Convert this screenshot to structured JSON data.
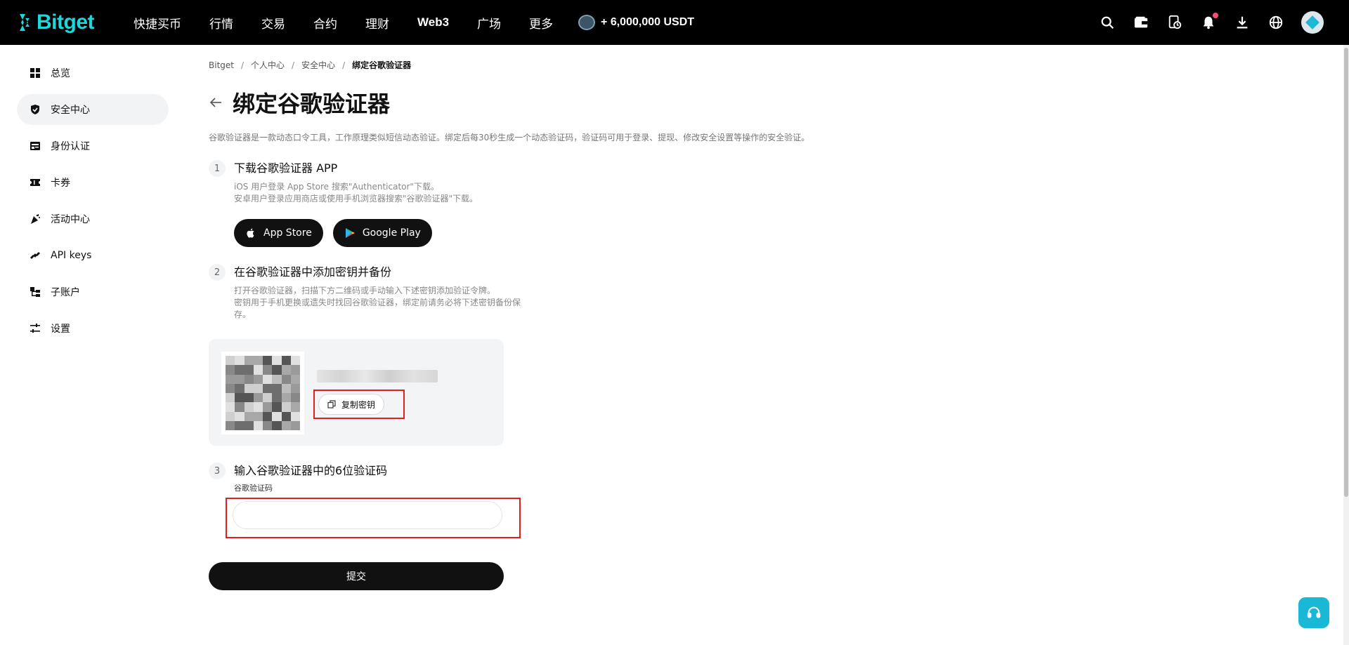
{
  "brand": {
    "name": "Bitget",
    "color": "#1ed7db"
  },
  "nav": {
    "items": [
      "快捷买币",
      "行情",
      "交易",
      "合约",
      "理财",
      "Web3",
      "广场",
      "更多"
    ],
    "promo": "+ 6,000,000 USDT"
  },
  "top_icons": [
    "search-icon",
    "wallet-icon",
    "orders-icon",
    "bell-icon",
    "download-icon",
    "globe-icon"
  ],
  "sidebar": {
    "items": [
      {
        "label": "总览",
        "icon": "grid-icon"
      },
      {
        "label": "安全中心",
        "icon": "shield-icon",
        "active": true
      },
      {
        "label": "身份认证",
        "icon": "id-card-icon"
      },
      {
        "label": "卡券",
        "icon": "ticket-icon"
      },
      {
        "label": "活动中心",
        "icon": "party-icon"
      },
      {
        "label": "API keys",
        "icon": "api-icon"
      },
      {
        "label": "子账户",
        "icon": "subaccount-icon"
      },
      {
        "label": "设置",
        "icon": "settings-icon"
      }
    ]
  },
  "breadcrumb": [
    "Bitget",
    "个人中心",
    "安全中心",
    "绑定谷歌验证器"
  ],
  "page": {
    "title": "绑定谷歌验证器",
    "description": "谷歌验证器是一款动态口令工具，工作原理类似短信动态验证。绑定后每30秒生成一个动态验证码，验证码可用于登录、提现、修改安全设置等操作的安全验证。"
  },
  "steps": [
    {
      "num": "1",
      "title": "下载谷歌验证器 APP",
      "lines": [
        "iOS 用户登录 App Store 搜索\"Authenticator\"下载。",
        "安卓用户登录应用商店或使用手机浏览器搜索\"谷歌验证器\"下载。"
      ],
      "buttons": [
        "App Store",
        "Google Play"
      ]
    },
    {
      "num": "2",
      "title": "在谷歌验证器中添加密钥并备份",
      "lines": [
        "打开谷歌验证器，扫描下方二维码或手动输入下述密钥添加验证令牌。",
        "密钥用于手机更换或遗失时找回谷歌验证器，绑定前请务必将下述密钥备份保",
        "存。"
      ],
      "copy_label": "复制密钥"
    },
    {
      "num": "3",
      "title": "输入谷歌验证器中的6位验证码",
      "field_label": "谷歌验证码",
      "placeholder": ""
    }
  ],
  "submit_label": "提交",
  "colors": {
    "highlight": "#e02020",
    "support": "#19b8d6"
  }
}
